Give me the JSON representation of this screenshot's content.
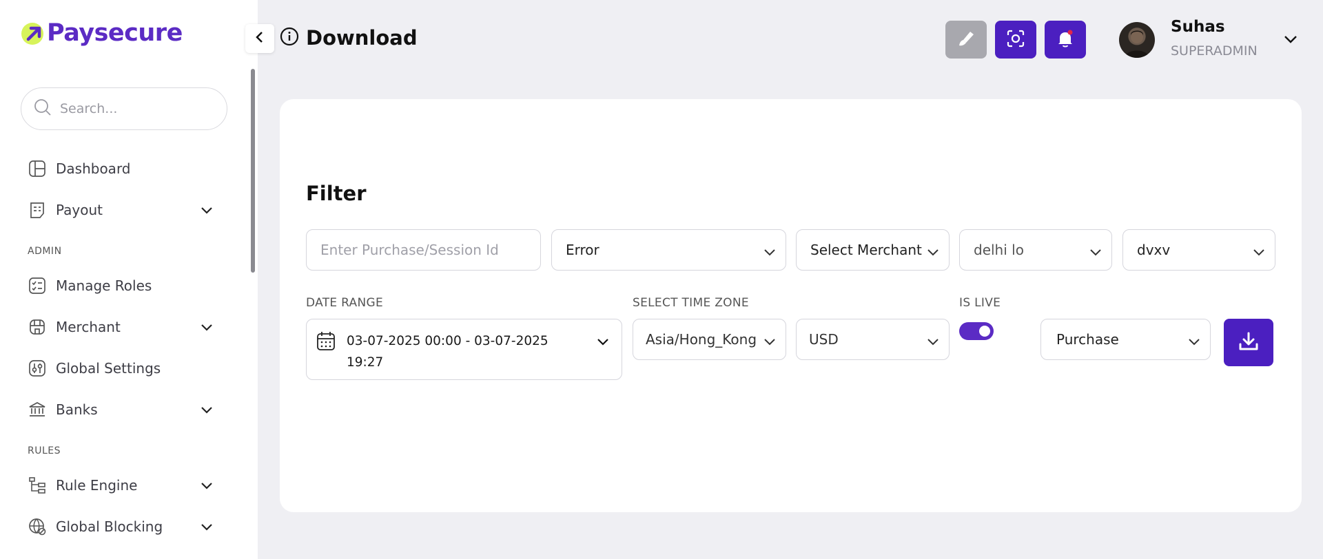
{
  "brand": {
    "name": "Paysecure",
    "accent": "#5b2bc4",
    "logo_mark_color": "#d7f35a"
  },
  "sidebar": {
    "search_placeholder": "Search...",
    "items": [
      {
        "label": "Dashboard",
        "icon": "dashboard-icon",
        "has_children": false
      },
      {
        "label": "Payout",
        "icon": "receipt-icon",
        "has_children": true
      },
      {
        "label": "Manage Roles",
        "icon": "checklist-icon",
        "has_children": false
      },
      {
        "label": "Merchant",
        "icon": "merchant-icon",
        "has_children": true
      },
      {
        "label": "Global Settings",
        "icon": "sliders-icon",
        "has_children": false
      },
      {
        "label": "Banks",
        "icon": "bank-icon",
        "has_children": true
      },
      {
        "label": "Rule Engine",
        "icon": "flow-icon",
        "has_children": true
      },
      {
        "label": "Global Blocking",
        "icon": "globe-block-icon",
        "has_children": true
      }
    ],
    "sections": {
      "admin": "ADMIN",
      "rules": "RULES"
    }
  },
  "header": {
    "title": "Download",
    "buttons": [
      {
        "icon": "clear-brush-icon",
        "color": "#a8a8ae"
      },
      {
        "icon": "screenshot-icon",
        "color": "#4b1fc0"
      },
      {
        "icon": "bell-icon",
        "color": "#4b1fc0"
      }
    ],
    "user": {
      "name": "Suhas",
      "role": "SUPERADMIN"
    }
  },
  "filter": {
    "title": "Filter",
    "purchase_id_placeholder": "Enter Purchase/Session Id",
    "status_value": "Error",
    "merchant_value": "Select Merchant",
    "location_value": "delhi lo",
    "extra_value": "dvxv",
    "date_range_label": "DATE RANGE",
    "date_range_value": "03-07-2025 00:00 - 03-07-2025 19:27",
    "time_zone_label": "SELECT TIME ZONE",
    "time_zone_value": "Asia/Hong_Kong",
    "currency_value": "USD",
    "is_live_label": "IS LIVE",
    "is_live": true,
    "type_value": "Purchase",
    "download_icon": "download-icon"
  }
}
